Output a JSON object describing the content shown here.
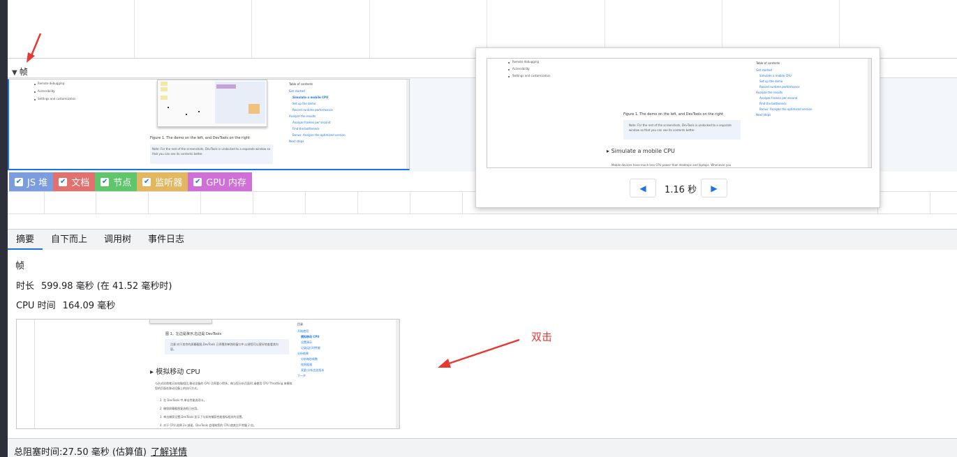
{
  "frames_section": {
    "label": "帧"
  },
  "legend": [
    {
      "label": "JS 堆",
      "color": "#7b9de0"
    },
    {
      "label": "文档",
      "color": "#e0716e"
    },
    {
      "label": "节点",
      "color": "#5fc66b"
    },
    {
      "label": "监听器",
      "color": "#e3b660"
    },
    {
      "label": "GPU 内存",
      "color": "#d16fd9"
    }
  ],
  "tabs": [
    "摘要",
    "自下而上",
    "调用树",
    "事件日志"
  ],
  "summary": {
    "title": "帧",
    "duration_label": "时长",
    "duration_value": "599.98 毫秒",
    "duration_at": "(在 41.52 毫秒时)",
    "cpu_label": "CPU 时间",
    "cpu_value": "164.09 毫秒"
  },
  "popup": {
    "time": "1.16 秒"
  },
  "annotation": {
    "text": "双击"
  },
  "footer": {
    "text": "总阻塞时间:27.50 毫秒 (估算值)",
    "link": "了解详情"
  },
  "thumb_doc": {
    "bullets": [
      "Remote debugging",
      "Accessibility",
      "Settings and customization"
    ],
    "toc_title": "Table of contents",
    "toc": [
      "Get started",
      "Simulate a mobile CPU",
      "Set up the demo",
      "Record runtime performance",
      "Analyze the results",
      "Analyze frames per second",
      "Find the bottleneck",
      "Bonus: Analyze the optimized version",
      "Next steps"
    ],
    "caption": "Figure 1. The demo on the left, and DevTools on the right",
    "note": "Note: For the rest of the screenshots, DevTools is undocked to a separate window so that you can see its contents better.",
    "heading": "Simulate a mobile CPU",
    "para": "Mobile devices have much less CPU power than desktops and laptops. Whenever you"
  },
  "preview_doc": {
    "caption": "图 1。左边是演示,右边是 DevTools",
    "note": "注意:对于其余的屏幕截图,DevTools 已停靠到单独的窗口中,以便您可以更好地查看其内容。",
    "heading": "模拟移动 CPU",
    "para": "与台式机和笔记本电脑相比,移动设备的 CPU 功率要小得多。每当您分析页面时,请使用 CPU Throttling 来模拟您的页面在移动设备上的执行方式。",
    "steps": [
      "在 DevTools 中,单击性能选项卡。",
      "确保屏幕截图复选框已启用。",
      "单击捕获设置,DevTools 显示了与如何捕获性能指标相关的设置。",
      "对于 CPU,选择 2x 减速。DevTools 会限制您的 CPU,使其比平常慢 2 倍。"
    ],
    "toc_title": "目录",
    "toc": [
      "开始使用",
      "模拟移动 CPU",
      "设置演示",
      "记录运行时性能",
      "分析结果",
      "分析每秒帧数",
      "找到瓶颈",
      "奖励:分析优化版本",
      "下一步"
    ]
  }
}
